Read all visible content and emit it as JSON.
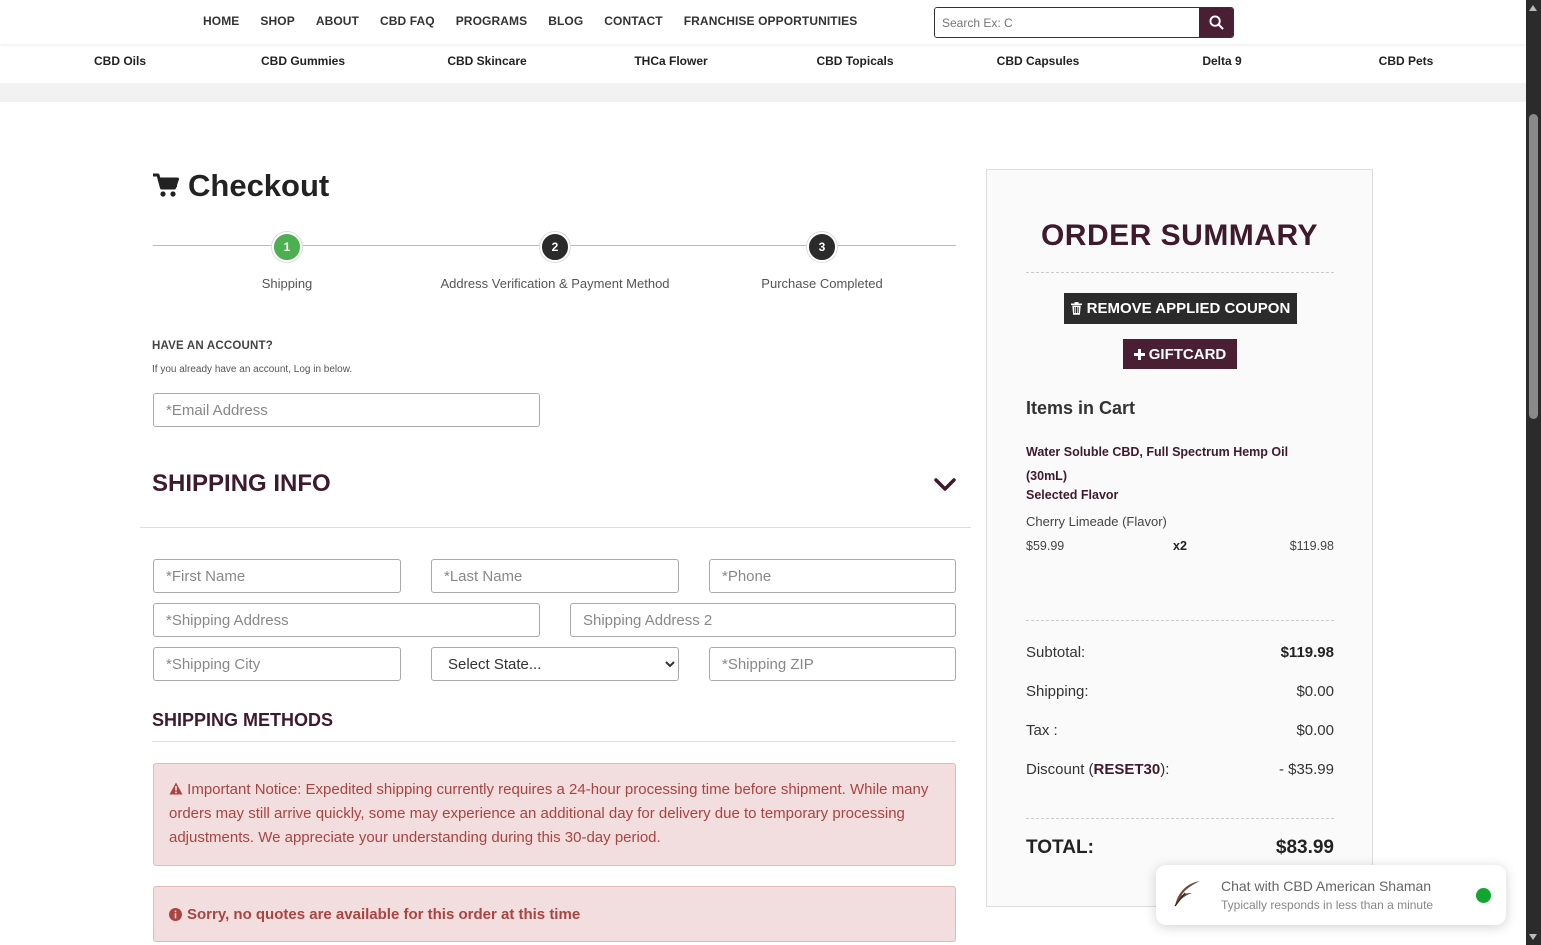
{
  "nav": {
    "items": [
      "HOME",
      "SHOP",
      "ABOUT",
      "CBD FAQ",
      "PROGRAMS",
      "BLOG",
      "CONTACT",
      "FRANCHISE OPPORTUNITIES"
    ]
  },
  "search": {
    "placeholder": "Search Ex: C"
  },
  "categories": [
    "CBD Oils",
    "CBD Gummies",
    "CBD Skincare",
    "THCa Flower",
    "CBD Topicals",
    "CBD Capsules",
    "Delta 9",
    "CBD Pets"
  ],
  "checkout": {
    "title": "Checkout",
    "steps": [
      {
        "num": "1",
        "label": "Shipping",
        "color": "#4caf50"
      },
      {
        "num": "2",
        "label": "Address Verification & Payment Method",
        "color": "#2b2b2b"
      },
      {
        "num": "3",
        "label": "Purchase Completed",
        "color": "#2b2b2b"
      }
    ]
  },
  "account": {
    "heading": "HAVE AN ACCOUNT?",
    "subtext": "If you already have an account, Log in below.",
    "email_placeholder": "*Email Address"
  },
  "shipping": {
    "heading": "SHIPPING INFO",
    "first_name": "*First Name",
    "last_name": "*Last Name",
    "phone": "*Phone",
    "address": "*Shipping Address",
    "address2": "Shipping Address 2",
    "city": "*Shipping City",
    "state": "Select State...",
    "zip": "*Shipping ZIP"
  },
  "methods": {
    "heading": "SHIPPING METHODS",
    "notice": "Important Notice: Expedited shipping currently requires a 24-hour processing time before shipment. While many orders may still arrive quickly, some may experience an additional day for delivery due to temporary processing adjustments. We appreciate your understanding during this 30-day period.",
    "no_quotes": "Sorry, no quotes are available for this order at this time"
  },
  "summary": {
    "title": "ORDER SUMMARY",
    "remove_coupon": "REMOVE APPLIED COUPON",
    "giftcard": "GIFTCARD",
    "items_heading": "Items in Cart",
    "product_name": "Water Soluble CBD, Full Spectrum Hemp Oil (30mL)",
    "flavor_label": "Selected Flavor",
    "flavor_value": "Cherry Limeade (Flavor)",
    "unit_price": "$59.99",
    "qty": "x2",
    "line_total": "$119.98",
    "subtotal_label": "Subtotal:",
    "subtotal_value": "$119.98",
    "shipping_label": "Shipping:",
    "shipping_value": "$0.00",
    "tax_label": "Tax :",
    "tax_value": "$0.00",
    "discount_label_pre": "Discount (",
    "discount_code": "RESET30",
    "discount_label_post": "):",
    "discount_value": "- $35.99",
    "total_label": "TOTAL:",
    "total_value": "$83.99"
  },
  "chat": {
    "title": "Chat with CBD American Shaman",
    "subtitle": "Typically responds in less than a minute",
    "status_color": "#12a52f"
  },
  "colors": {
    "brand": "#4a1f33",
    "heading": "#3e1a2c",
    "alert_bg": "#f2dede",
    "alert_text": "#a94442"
  }
}
